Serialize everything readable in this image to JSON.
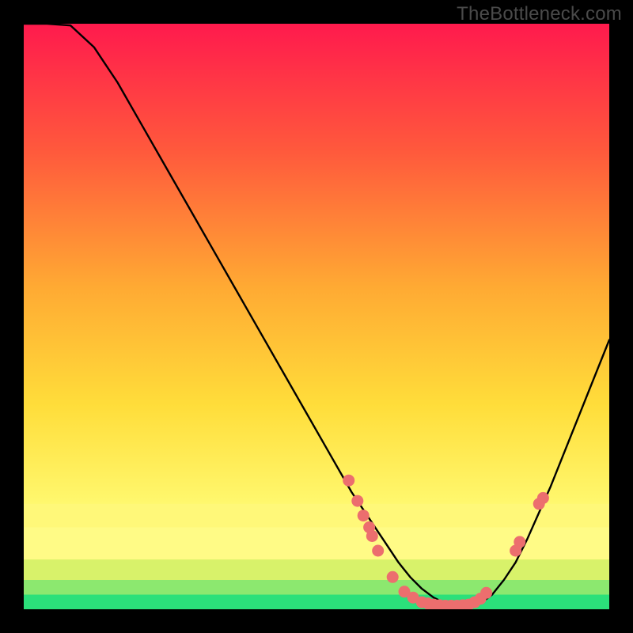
{
  "watermark": "TheBottleneck.com",
  "chart_data": {
    "type": "line",
    "title": "",
    "xlabel": "",
    "ylabel": "",
    "xlim": [
      0,
      100
    ],
    "ylim": [
      0,
      100
    ],
    "grid": false,
    "series": [
      {
        "name": "curve",
        "x": [
          0,
          4,
          8,
          12,
          16,
          20,
          24,
          28,
          32,
          36,
          40,
          44,
          48,
          52,
          56,
          58,
          60,
          62,
          64,
          66,
          68,
          70,
          72,
          74,
          76,
          78,
          80,
          82,
          84,
          86,
          88,
          90,
          92,
          94,
          96,
          98,
          100
        ],
        "y": [
          100,
          100,
          99.7,
          96,
          90,
          83,
          76,
          69,
          62,
          55,
          48,
          41,
          34,
          27,
          20,
          17,
          14,
          11,
          8,
          5.5,
          3.5,
          2,
          1,
          0.5,
          0.5,
          1,
          2.5,
          5,
          8,
          12,
          16.5,
          21,
          26,
          31,
          36,
          41,
          46
        ]
      }
    ],
    "markers": [
      {
        "x": 55.5,
        "y": 22
      },
      {
        "x": 57,
        "y": 18.5
      },
      {
        "x": 58,
        "y": 16
      },
      {
        "x": 59,
        "y": 14
      },
      {
        "x": 59.5,
        "y": 12.5
      },
      {
        "x": 60.5,
        "y": 10
      },
      {
        "x": 63,
        "y": 5.5
      },
      {
        "x": 65,
        "y": 3
      },
      {
        "x": 66.5,
        "y": 2
      },
      {
        "x": 68,
        "y": 1.2
      },
      {
        "x": 69,
        "y": 1
      },
      {
        "x": 70,
        "y": 0.8
      },
      {
        "x": 71,
        "y": 0.7
      },
      {
        "x": 72,
        "y": 0.6
      },
      {
        "x": 73,
        "y": 0.6
      },
      {
        "x": 74,
        "y": 0.6
      },
      {
        "x": 75,
        "y": 0.7
      },
      {
        "x": 76,
        "y": 0.8
      },
      {
        "x": 77,
        "y": 1.2
      },
      {
        "x": 78,
        "y": 1.8
      },
      {
        "x": 79,
        "y": 2.8
      },
      {
        "x": 84,
        "y": 10
      },
      {
        "x": 84.7,
        "y": 11.5
      },
      {
        "x": 88,
        "y": 18
      },
      {
        "x": 88.7,
        "y": 19
      }
    ],
    "bands": [
      {
        "y0": 0,
        "y1": 2.5,
        "color": "#2be07a"
      },
      {
        "y0": 2.5,
        "y1": 5,
        "color": "#8ce86f"
      },
      {
        "y0": 5,
        "y1": 8.5,
        "color": "#d8f26a"
      },
      {
        "y0": 8.5,
        "y1": 14,
        "color": "#fffb86"
      },
      {
        "y0": 14,
        "y1": 18,
        "color": "#fff879"
      }
    ],
    "gradient_stops": [
      {
        "offset": 0,
        "color": "#ff1a4d"
      },
      {
        "offset": 22,
        "color": "#ff5a3c"
      },
      {
        "offset": 45,
        "color": "#ffaa33"
      },
      {
        "offset": 65,
        "color": "#ffdd3a"
      },
      {
        "offset": 82,
        "color": "#fff86e"
      },
      {
        "offset": 100,
        "color": "#fff86e"
      }
    ],
    "marker_color": "#ec6e6e",
    "curve_color": "#000000"
  }
}
